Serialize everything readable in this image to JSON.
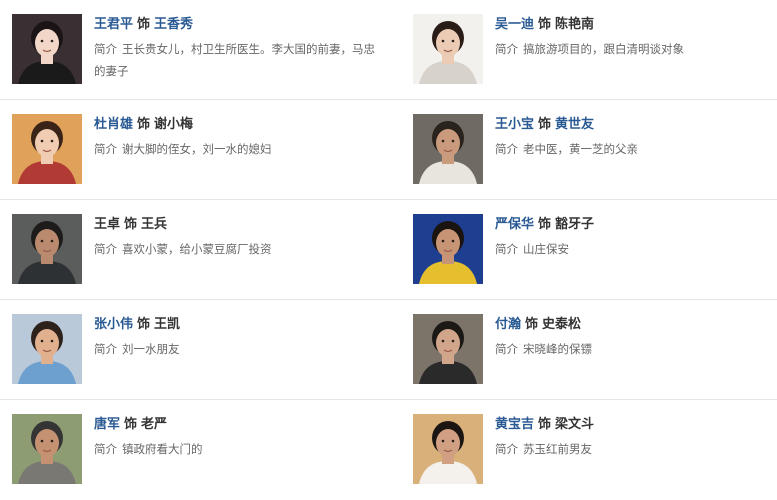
{
  "labels": {
    "role_word": "饰",
    "desc_label": "简介"
  },
  "cast": [
    {
      "actor": "王君平",
      "role": "王香秀",
      "actor_link": true,
      "role_link": true,
      "desc": "王长贵女儿，村卫生所医生。李大国的前妻，马忠的妻子",
      "photo": {
        "bg": "#3a3033",
        "skin": "#f2d7c9",
        "hair": "#1b1416",
        "shirt": "#1a1a1a",
        "icon": "actress-photo-icon"
      }
    },
    {
      "actor": "吴一迪",
      "role": "陈艳南",
      "actor_link": true,
      "role_link": false,
      "desc": "搞旅游项目的，跟白清明谈对象",
      "photo": {
        "bg": "#f3f1ee",
        "skin": "#eccbb5",
        "hair": "#2a1d18",
        "shirt": "#d8d2cc",
        "icon": "actress-photo-icon"
      }
    },
    {
      "actor": "杜肖雄",
      "role": "谢小梅",
      "actor_link": true,
      "role_link": false,
      "desc": "谢大脚的侄女，刘一水的媳妇",
      "photo": {
        "bg": "#e0a25a",
        "skin": "#f0ccb2",
        "hair": "#3a2418",
        "shirt": "#b23a35",
        "icon": "actress-photo-icon"
      }
    },
    {
      "actor": "王小宝",
      "role": "黄世友",
      "actor_link": true,
      "role_link": true,
      "desc": "老中医，黄一芝的父亲",
      "photo": {
        "bg": "#6f6a63",
        "skin": "#c99a7c",
        "hair": "#2a221d",
        "shirt": "#e8e4de",
        "icon": "actor-photo-icon"
      }
    },
    {
      "actor": "王卓",
      "role": "王兵",
      "actor_link": false,
      "role_link": false,
      "desc": "喜欢小蒙，给小蒙豆腐厂投资",
      "photo": {
        "bg": "#5b5d5c",
        "skin": "#b98a6e",
        "hair": "#1d1c1b",
        "shirt": "#2e3133",
        "icon": "actor-photo-icon"
      }
    },
    {
      "actor": "严保华",
      "role": "豁牙子",
      "actor_link": true,
      "role_link": false,
      "desc": "山庄保安",
      "photo": {
        "bg": "#1e3f8f",
        "skin": "#c79475",
        "hair": "#1a1410",
        "shirt": "#e5bf2e",
        "icon": "actor-photo-icon"
      }
    },
    {
      "actor": "张小伟",
      "role": "王凯",
      "actor_link": true,
      "role_link": false,
      "desc": "刘一水朋友",
      "photo": {
        "bg": "#b9c9d9",
        "skin": "#e1b08f",
        "hair": "#2c211b",
        "shirt": "#6da0cf",
        "icon": "actor-photo-icon"
      }
    },
    {
      "actor": "付瀚",
      "role": "史泰松",
      "actor_link": true,
      "role_link": false,
      "desc": "宋晓峰的保镖",
      "photo": {
        "bg": "#7c7468",
        "skin": "#d0a58a",
        "hair": "#1b1816",
        "shirt": "#2a2a2a",
        "icon": "actor-photo-icon"
      }
    },
    {
      "actor": "唐军",
      "role": "老严",
      "actor_link": true,
      "role_link": false,
      "desc": "镇政府看大门的",
      "photo": {
        "bg": "#8e9c74",
        "skin": "#c49272",
        "hair": "#343434",
        "shirt": "#7a7872",
        "icon": "actor-photo-icon"
      }
    },
    {
      "actor": "黄宝吉",
      "role": "梁文斗",
      "actor_link": true,
      "role_link": false,
      "desc": "苏玉红前男友",
      "photo": {
        "bg": "#d9b07a",
        "skin": "#d1a083",
        "hair": "#1c1612",
        "shirt": "#f4f1ec",
        "icon": "actor-photo-icon"
      }
    }
  ]
}
